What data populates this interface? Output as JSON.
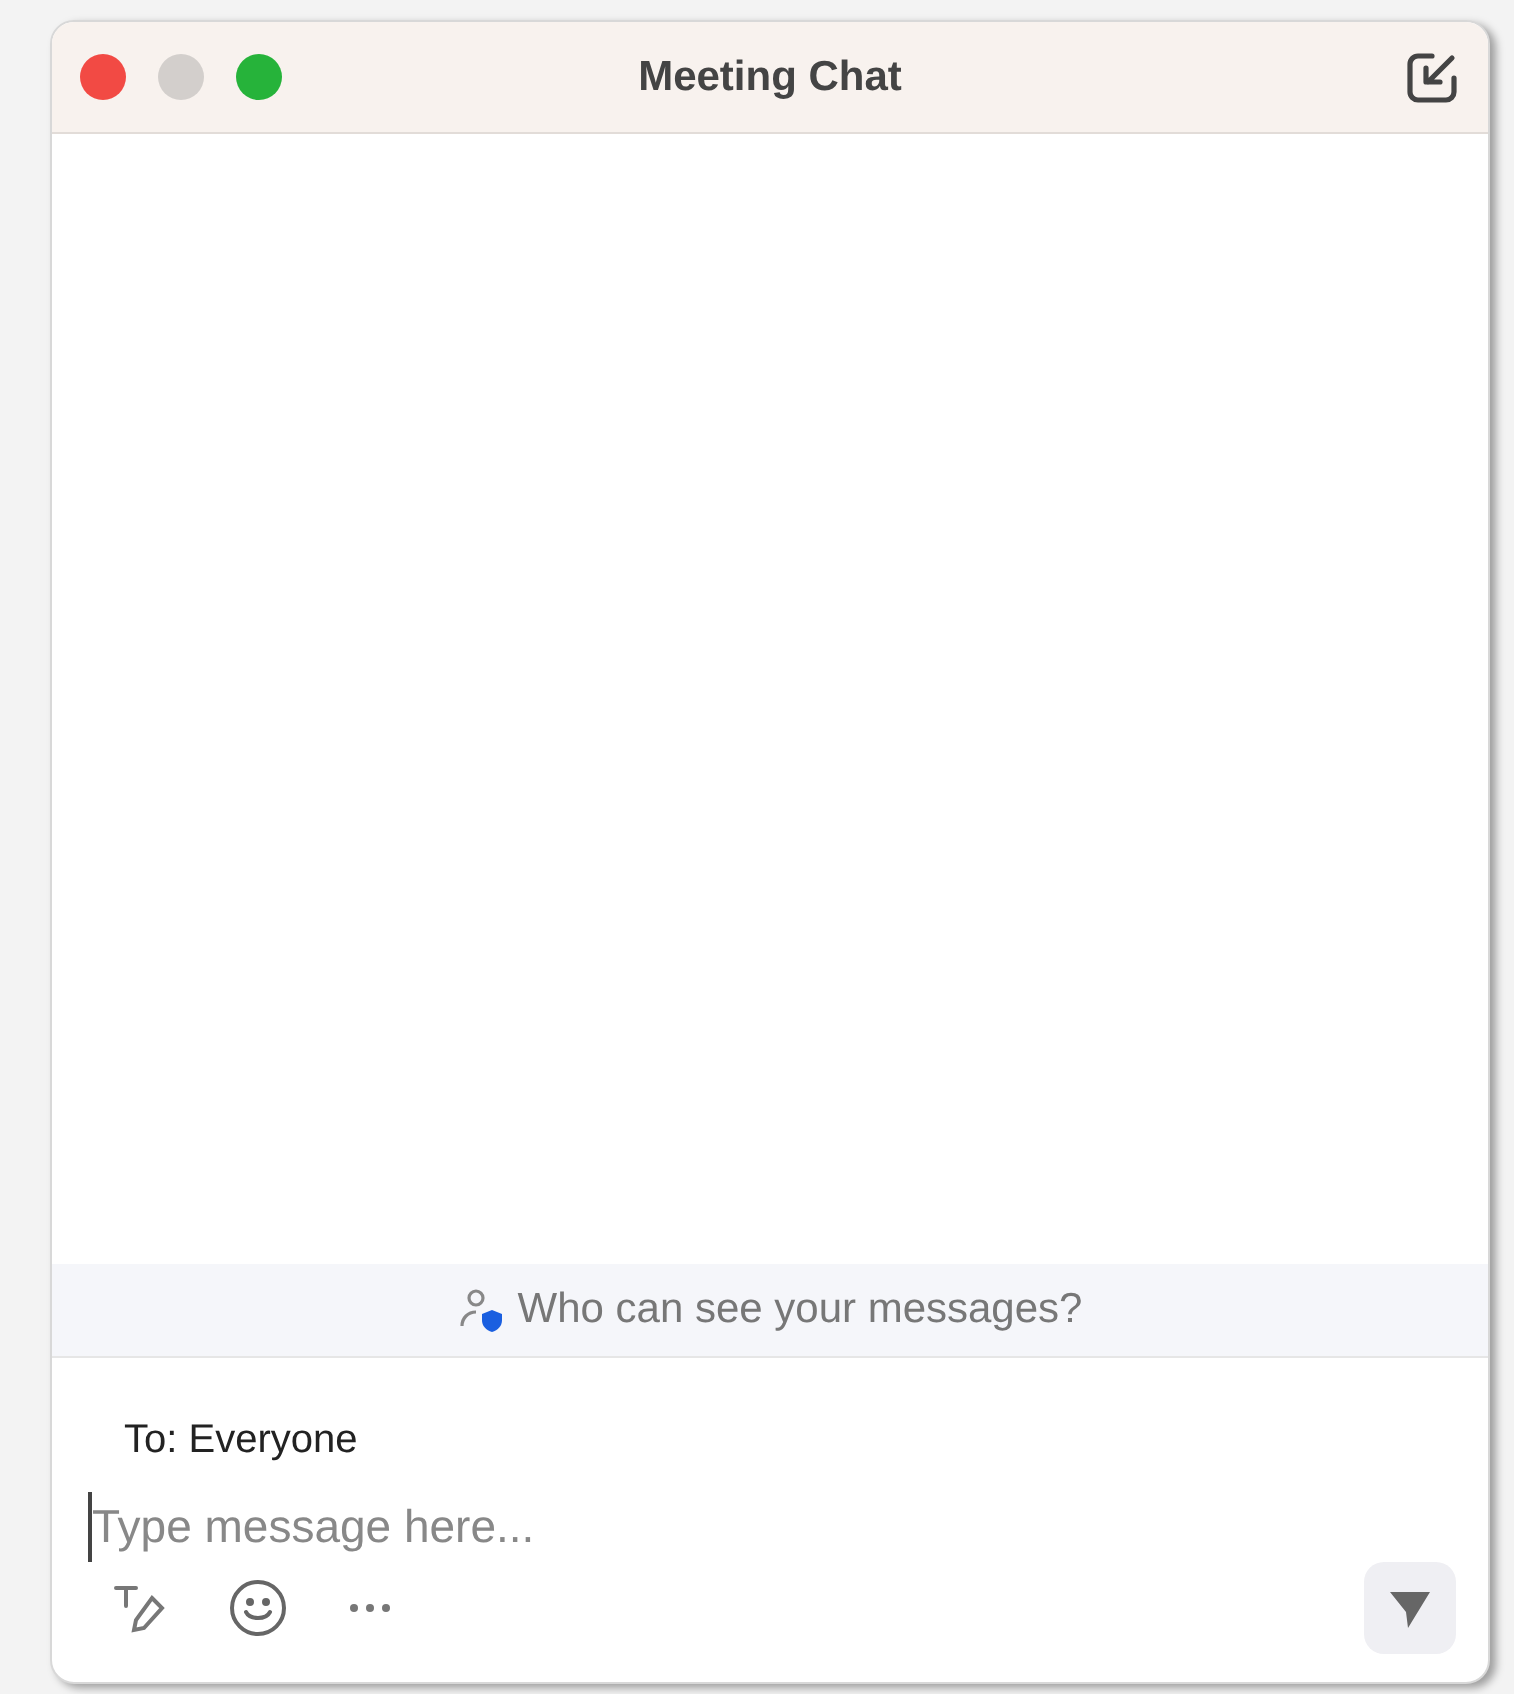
{
  "window": {
    "title": "Meeting Chat"
  },
  "notice": {
    "text": "Who can see your messages?"
  },
  "recipient": {
    "text": "To: Everyone"
  },
  "composer": {
    "placeholder": "Type message here..."
  }
}
